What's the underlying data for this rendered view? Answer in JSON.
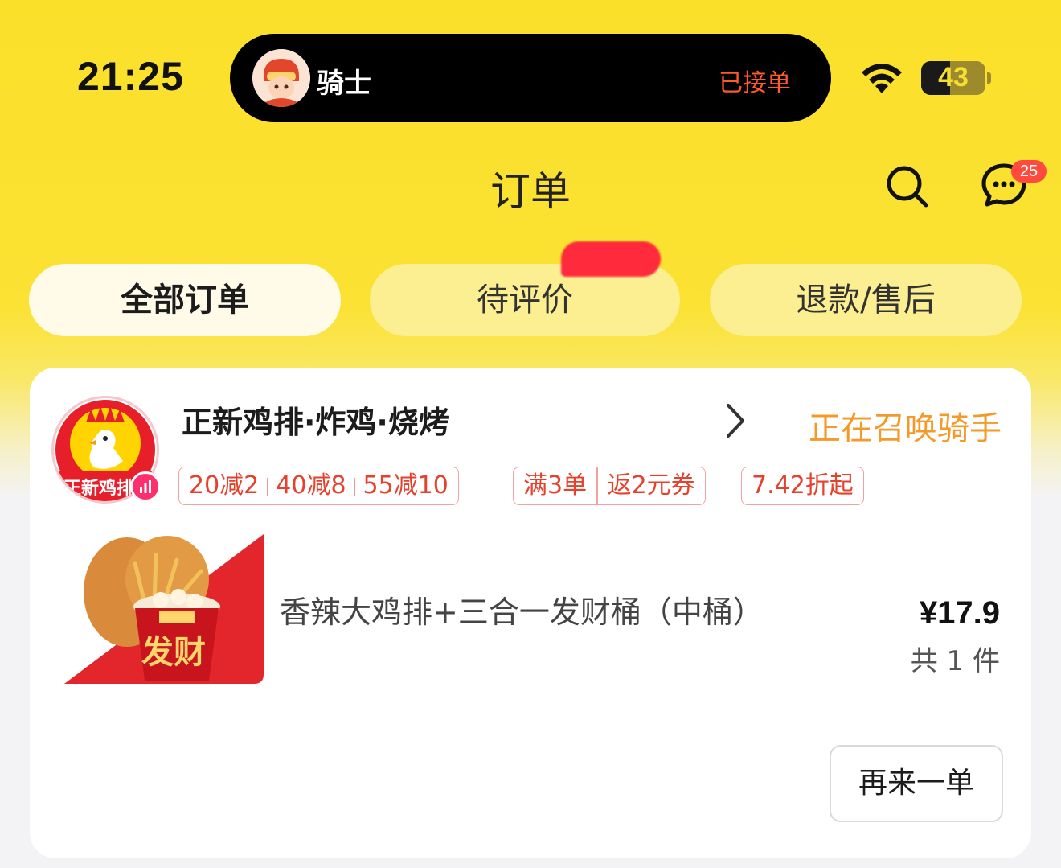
{
  "status_bar": {
    "time": "21:25",
    "battery": "43"
  },
  "live_activity": {
    "role": "骑士",
    "status": "已接单"
  },
  "header": {
    "title": "订单",
    "message_badge": "25"
  },
  "tabs": [
    {
      "label": "全部订单",
      "active": true
    },
    {
      "label": "待评价",
      "active": false
    },
    {
      "label": "退款/售后",
      "active": false
    }
  ],
  "order": {
    "store_name": "正新鸡排·炸鸡·烧烤",
    "store_logo_text": "正新鸡排",
    "status": "正在召唤骑手",
    "promos": {
      "discounts": [
        "20减2",
        "40减8",
        "55减10"
      ],
      "cashback_left": "满3单",
      "cashback_right": "返2元券",
      "rebate": "7.42折起"
    },
    "item_name": "香辣大鸡排+三合一发财桶（中桶）",
    "price": "¥17.9",
    "count": "共 1 件",
    "food_image_caption": "发财",
    "reorder_label": "再来一单"
  },
  "colors": {
    "brand_yellow": "#fbe02a",
    "status_orange": "#f39a2a",
    "promo_red": "#e5412d",
    "badge_red": "#ff4b3e"
  }
}
